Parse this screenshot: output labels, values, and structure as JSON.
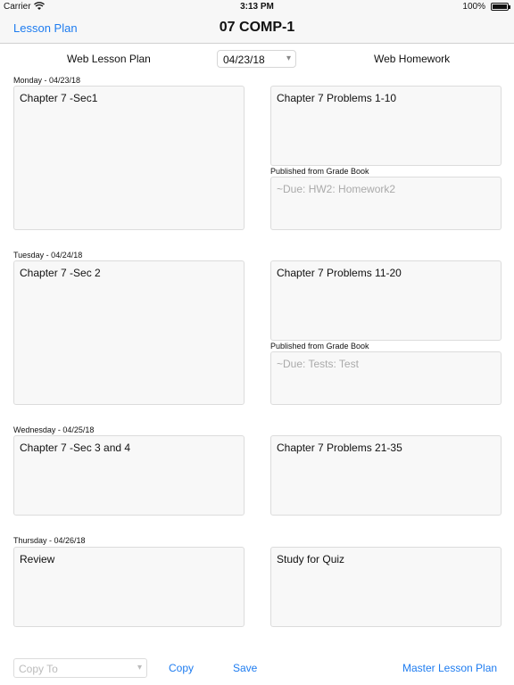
{
  "status_bar": {
    "carrier": "Carrier",
    "time": "3:13 PM",
    "battery": "100%"
  },
  "nav": {
    "back_label": "Lesson Plan",
    "title": "07 COMP-1"
  },
  "header": {
    "left_label": "Web Lesson Plan",
    "date_value": "04/23/18",
    "right_label": "Web Homework"
  },
  "days": [
    {
      "label": "Monday - 04/23/18",
      "lesson": "Chapter 7 -Sec1",
      "homework": "Chapter 7 Problems 1-10",
      "published_label": "Published from Grade Book",
      "published": "~Due: HW2: Homework2"
    },
    {
      "label": "Tuesday - 04/24/18",
      "lesson": "Chapter 7 -Sec 2",
      "homework": "Chapter 7 Problems 11-20",
      "published_label": "Published from Grade Book",
      "published": "~Due: Tests: Test"
    },
    {
      "label": "Wednesday - 04/25/18",
      "lesson": "Chapter 7 -Sec 3 and 4",
      "homework": "Chapter 7 Problems 21-35"
    },
    {
      "label": "Thursday - 04/26/18",
      "lesson": "Review",
      "homework": "Study for Quiz"
    }
  ],
  "bottom": {
    "copy_to_placeholder": "Copy To",
    "copy_label": "Copy",
    "save_label": "Save",
    "master_label": "Master Lesson Plan"
  }
}
